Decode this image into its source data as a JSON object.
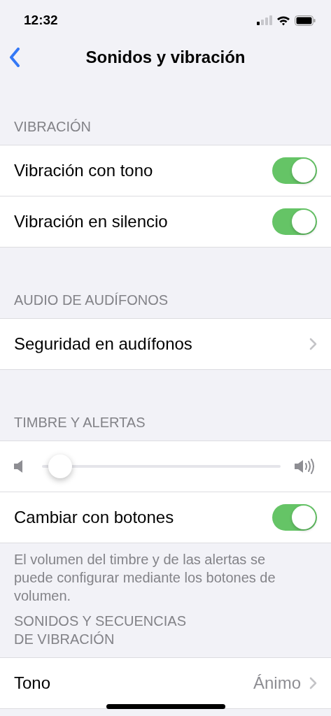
{
  "status_bar": {
    "time": "12:32"
  },
  "nav": {
    "title": "Sonidos y vibración"
  },
  "sections": [
    {
      "header": "VIBRACIÓN",
      "rows": [
        {
          "kind": "toggle",
          "label": "Vibración con tono",
          "on": true
        },
        {
          "kind": "toggle",
          "label": "Vibración en silencio",
          "on": true
        }
      ]
    },
    {
      "header": "AUDIO DE AUDÍFONOS",
      "rows": [
        {
          "kind": "link",
          "label": "Seguridad en audífonos"
        }
      ]
    },
    {
      "header": "TIMBRE Y ALERTAS",
      "rows": [
        {
          "kind": "slider",
          "level": 0.03
        },
        {
          "kind": "toggle",
          "label": "Cambiar con botones",
          "on": true
        }
      ],
      "footer": "El volumen del timbre y de las alertas se puede configurar mediante los botones de volumen."
    },
    {
      "header": "SONIDOS Y SECUENCIAS\nDE VIBRACIÓN",
      "rows": [
        {
          "kind": "link",
          "label": "Tono",
          "value": "Ánimo"
        }
      ]
    }
  ]
}
